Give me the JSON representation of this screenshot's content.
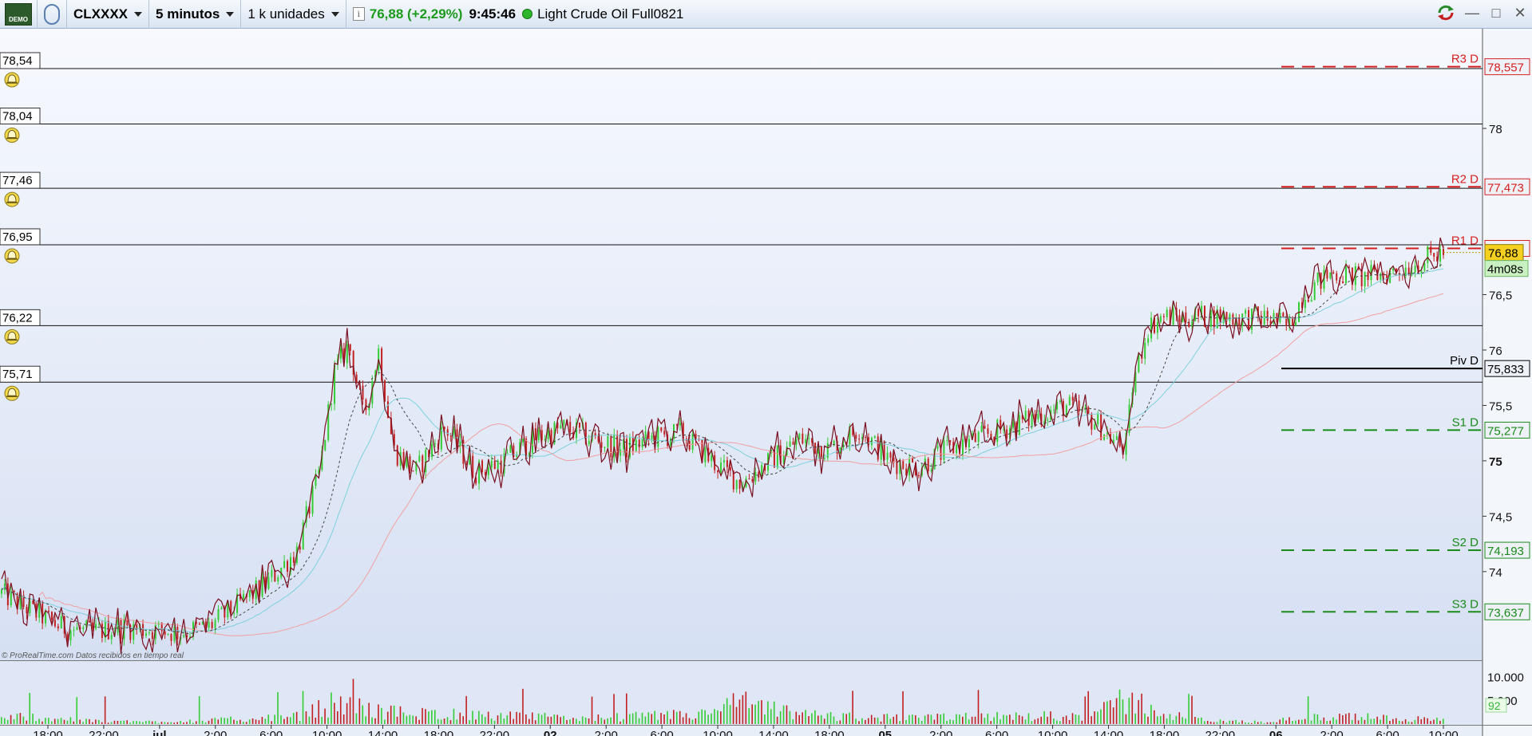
{
  "toolbar": {
    "demo_label": "DEMO",
    "symbol": "CLXXXX",
    "timeframe": "5 minutos",
    "units": "1 k unidades",
    "price_change": "76,88 (+2,29%)",
    "time": "9:45:46",
    "instrument": "Light Crude Oil Full0821"
  },
  "window_controls": [
    "sync-icon",
    "minimize-icon",
    "maximize-icon",
    "close-icon"
  ],
  "colors": {
    "bg_top": "#f4f7fd",
    "bg_bottom": "#d9e3f4",
    "candle_up": "#33cc33",
    "candle_down": "#c22020",
    "resistance": "#d62020",
    "support": "#1a8a1a",
    "price_tag": "#f5d020"
  },
  "alerts": [
    {
      "label": "78,54",
      "value": 78.54
    },
    {
      "label": "78,04",
      "value": 78.04
    },
    {
      "label": "77,46",
      "value": 77.46
    },
    {
      "label": "76,95",
      "value": 76.95
    },
    {
      "label": "76,22",
      "value": 76.22
    },
    {
      "label": "75,71",
      "value": 75.71
    }
  ],
  "pivots": [
    {
      "name": "R3 D",
      "value": 78.557,
      "label": "78,557",
      "kind": "resistance"
    },
    {
      "name": "R2 D",
      "value": 77.473,
      "label": "77,473",
      "kind": "resistance"
    },
    {
      "name": "R1 D",
      "value": 76.917,
      "label": "76,917",
      "kind": "resistance"
    },
    {
      "name": "Piv D",
      "value": 75.833,
      "label": "75,833",
      "kind": "pivot"
    },
    {
      "name": "S1 D",
      "value": 75.277,
      "label": "75,277",
      "kind": "support"
    },
    {
      "name": "S2 D",
      "value": 74.193,
      "label": "74,193",
      "kind": "support"
    },
    {
      "name": "S3 D",
      "value": 73.637,
      "label": "73,637",
      "kind": "support"
    }
  ],
  "current_price": {
    "label": "76,88",
    "value": 76.88,
    "countdown": "4m08s"
  },
  "footer_note": "© ProRealTime.com  Datos recibidos en tiempo real",
  "chart_data": {
    "type": "candlestick",
    "price_axis": {
      "range": [
        73.2,
        78.9
      ],
      "ticks": [
        {
          "label": "78",
          "value": 78
        },
        {
          "label": "76,5",
          "value": 76.5
        },
        {
          "label": "76",
          "value": 76
        },
        {
          "label": "75,5",
          "value": 75.5
        },
        {
          "label": "75",
          "value": 75,
          "bold": true
        },
        {
          "label": "74,5",
          "value": 74.5
        },
        {
          "label": "74",
          "value": 74
        }
      ]
    },
    "volume_axis": {
      "range": [
        0,
        13000
      ],
      "ticks": [
        {
          "label": "10.000",
          "value": 10000
        },
        {
          "label": "5.000",
          "value": 5000
        }
      ],
      "current_volume": "92"
    },
    "time_axis": {
      "ticks": [
        {
          "label": "18:00"
        },
        {
          "label": "22:00"
        },
        {
          "label": "jul",
          "bold": true
        },
        {
          "label": "2:00"
        },
        {
          "label": "6:00"
        },
        {
          "label": "10:00"
        },
        {
          "label": "14:00"
        },
        {
          "label": "18:00"
        },
        {
          "label": "22:00"
        },
        {
          "label": "02",
          "bold": true
        },
        {
          "label": "2:00"
        },
        {
          "label": "6:00"
        },
        {
          "label": "10:00"
        },
        {
          "label": "14:00"
        },
        {
          "label": "18:00"
        },
        {
          "label": "05",
          "bold": true
        },
        {
          "label": "2:00"
        },
        {
          "label": "6:00"
        },
        {
          "label": "10:00"
        },
        {
          "label": "14:00"
        },
        {
          "label": "18:00"
        },
        {
          "label": "22:00"
        },
        {
          "label": "06",
          "bold": true
        },
        {
          "label": "2:00"
        },
        {
          "label": "6:00"
        },
        {
          "label": "10:00"
        }
      ]
    },
    "price_path": [
      [
        0,
        73.8
      ],
      [
        0.02,
        73.65
      ],
      [
        0.04,
        73.5
      ],
      [
        0.06,
        73.45
      ],
      [
        0.08,
        73.5
      ],
      [
        0.1,
        73.48
      ],
      [
        0.12,
        73.45
      ],
      [
        0.14,
        73.5
      ],
      [
        0.16,
        73.7
      ],
      [
        0.18,
        73.9
      ],
      [
        0.2,
        74.2
      ],
      [
        0.215,
        74.9
      ],
      [
        0.225,
        75.8
      ],
      [
        0.235,
        76.05
      ],
      [
        0.245,
        75.4
      ],
      [
        0.255,
        76.0
      ],
      [
        0.265,
        75.1
      ],
      [
        0.28,
        74.9
      ],
      [
        0.3,
        75.3
      ],
      [
        0.32,
        74.9
      ],
      [
        0.34,
        75.0
      ],
      [
        0.36,
        75.2
      ],
      [
        0.38,
        75.3
      ],
      [
        0.4,
        75.2
      ],
      [
        0.42,
        75.1
      ],
      [
        0.44,
        75.2
      ],
      [
        0.46,
        75.25
      ],
      [
        0.48,
        75.0
      ],
      [
        0.5,
        74.8
      ],
      [
        0.52,
        75.0
      ],
      [
        0.54,
        75.2
      ],
      [
        0.56,
        75.1
      ],
      [
        0.58,
        75.3
      ],
      [
        0.6,
        75.0
      ],
      [
        0.62,
        74.95
      ],
      [
        0.64,
        75.1
      ],
      [
        0.66,
        75.2
      ],
      [
        0.68,
        75.3
      ],
      [
        0.7,
        75.4
      ],
      [
        0.72,
        75.5
      ],
      [
        0.74,
        75.35
      ],
      [
        0.75,
        75.2
      ],
      [
        0.76,
        75.1
      ],
      [
        0.765,
        75.7
      ],
      [
        0.775,
        76.2
      ],
      [
        0.785,
        76.3
      ],
      [
        0.8,
        76.3
      ],
      [
        0.83,
        76.3
      ],
      [
        0.86,
        76.28
      ],
      [
        0.87,
        76.2
      ],
      [
        0.88,
        76.5
      ],
      [
        0.89,
        76.6
      ],
      [
        0.9,
        76.7
      ],
      [
        0.92,
        76.65
      ],
      [
        0.94,
        76.7
      ],
      [
        0.96,
        76.8
      ],
      [
        0.975,
        76.88
      ]
    ],
    "volume_profile": [
      [
        0,
        1500
      ],
      [
        0.02,
        2000
      ],
      [
        0.04,
        1200
      ],
      [
        0.06,
        800
      ],
      [
        0.1,
        600
      ],
      [
        0.14,
        900
      ],
      [
        0.2,
        1800
      ],
      [
        0.225,
        5000
      ],
      [
        0.24,
        4500
      ],
      [
        0.26,
        3000
      ],
      [
        0.3,
        2500
      ],
      [
        0.34,
        2000
      ],
      [
        0.4,
        1500
      ],
      [
        0.48,
        2500
      ],
      [
        0.5,
        5500
      ],
      [
        0.54,
        2500
      ],
      [
        0.58,
        1800
      ],
      [
        0.62,
        1500
      ],
      [
        0.66,
        1800
      ],
      [
        0.7,
        2000
      ],
      [
        0.74,
        2200
      ],
      [
        0.77,
        6000
      ],
      [
        0.79,
        2500
      ],
      [
        0.82,
        800
      ],
      [
        0.86,
        500
      ],
      [
        0.88,
        1500
      ],
      [
        0.92,
        1800
      ],
      [
        0.96,
        1400
      ],
      [
        0.98,
        900
      ]
    ]
  }
}
